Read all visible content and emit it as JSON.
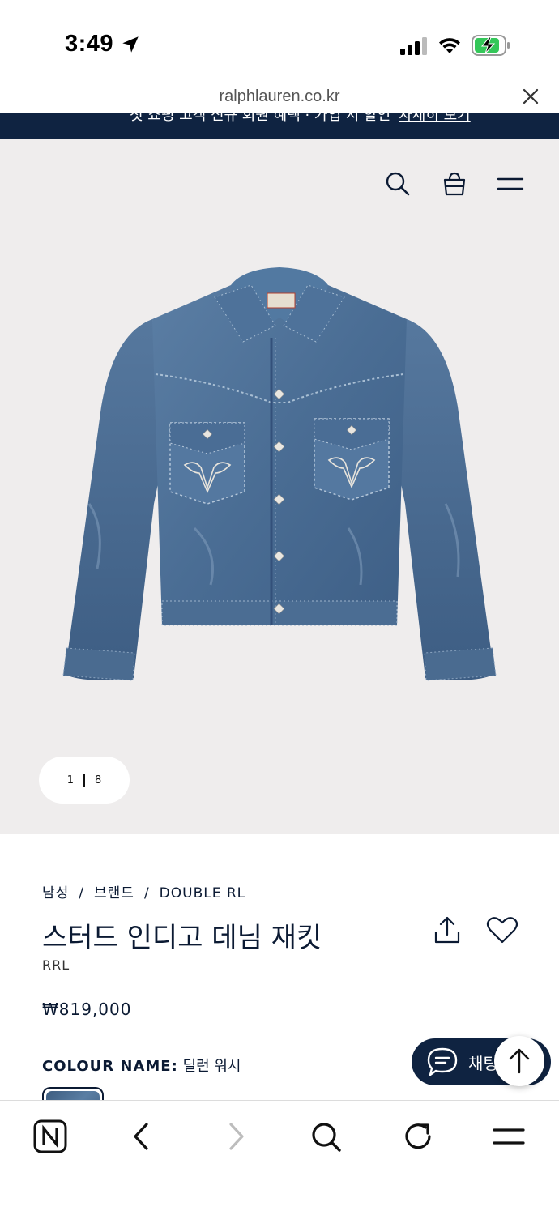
{
  "status_bar": {
    "time": "3:49",
    "icons": [
      "location-arrow-icon",
      "cellular-signal-icon",
      "wifi-icon",
      "battery-charging-icon"
    ]
  },
  "browser": {
    "url": "ralphlauren.co.kr",
    "close_icon": "close-icon"
  },
  "promo_banner": {
    "text": "첫 쇼핑 고객 신규 회원 혜택 · 가입 시 할인",
    "link": "자세히 보기"
  },
  "header_icons": [
    "search-icon",
    "shopping-bag-icon",
    "menu-icon"
  ],
  "gallery": {
    "current": "1",
    "total": "8",
    "image": "denim-jacket-image"
  },
  "product": {
    "breadcrumb": [
      "남성",
      "브랜드",
      "DOUBLE RL"
    ],
    "breadcrumb_separator": "/",
    "title": "스터드 인디고 데님 재킷",
    "brand": "RRL",
    "price": "₩819,000",
    "colour_label": "COLOUR NAME:",
    "colour_value": "딜런 워시",
    "swatch_color": "#4a6b8f"
  },
  "chat": {
    "label": "채팅",
    "icon": "chat-bubble-icon",
    "top_icon": "arrow-up-icon"
  },
  "toolbar": {
    "icons": [
      "naver-logo-icon",
      "back-icon",
      "forward-icon",
      "search-icon",
      "refresh-icon",
      "menu-icon"
    ]
  },
  "colors": {
    "navy": "#0f2341",
    "hero_background": "#efeded",
    "denim": "#4a6b8f"
  }
}
